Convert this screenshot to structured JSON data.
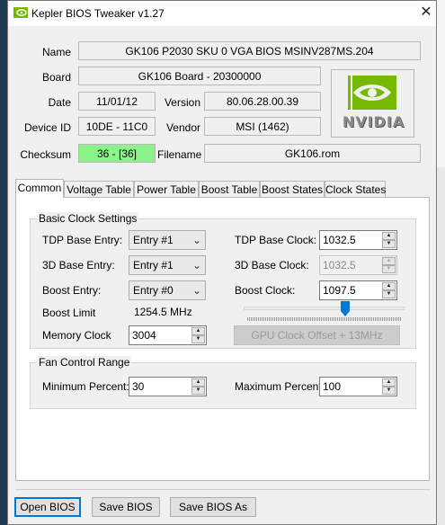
{
  "window": {
    "title": "Kepler BIOS Tweaker v1.27",
    "close_glyph": "✕"
  },
  "info": {
    "name_label": "Name",
    "name_value": "GK106 P2030 SKU 0 VGA BIOS MSINV287MS.204",
    "board_label": "Board",
    "board_value": "GK106 Board - 20300000",
    "date_label": "Date",
    "date_value": "11/01/12",
    "version_label": "Version",
    "version_value": "80.06.28.00.39",
    "device_label": "Device ID",
    "device_value": "10DE - 11C0",
    "vendor_label": "Vendor",
    "vendor_value": "MSI (1462)",
    "checksum_label": "Checksum",
    "checksum_value": "36 - [36]",
    "checksum_color": "#8cf28a",
    "filename_label": "Filename",
    "filename_value": "GK106.rom",
    "logo_text": "NVIDIA",
    "logo_color": "#76b900"
  },
  "tabs": [
    {
      "label": "Common",
      "active": true
    },
    {
      "label": "Voltage Table"
    },
    {
      "label": "Power Table"
    },
    {
      "label": "Boost Table"
    },
    {
      "label": "Boost States"
    },
    {
      "label": "Clock States"
    }
  ],
  "basic_clock": {
    "group_title": "Basic Clock Settings",
    "tdp_base_entry_label": "TDP Base Entry:",
    "tdp_base_entry_value": "Entry #1",
    "base3d_entry_label": "3D Base Entry:",
    "base3d_entry_value": "Entry #1",
    "boost_entry_label": "Boost Entry:",
    "boost_entry_value": "Entry #0",
    "boost_limit_label": "Boost Limit",
    "boost_limit_value": "1254.5 MHz",
    "memory_clock_label": "Memory Clock",
    "memory_clock_value": "3004",
    "tdp_base_clock_label": "TDP Base Clock:",
    "tdp_base_clock_value": "1032.5",
    "base3d_clock_label": "3D Base Clock:",
    "base3d_clock_value": "1032.5",
    "boost_clock_label": "Boost Clock:",
    "boost_clock_value": "1097.5",
    "offset_button": "GPU Clock Offset + 13MHz",
    "slider_color": "#0078d7"
  },
  "fan": {
    "group_title": "Fan Control Range",
    "min_label": "Minimum Percent:",
    "min_value": "30",
    "max_label": "Maximum Percent:",
    "max_value": "100"
  },
  "footer": {
    "open_label": "Open BIOS",
    "save_label": "Save BIOS",
    "save_as_label": "Save BIOS As"
  }
}
